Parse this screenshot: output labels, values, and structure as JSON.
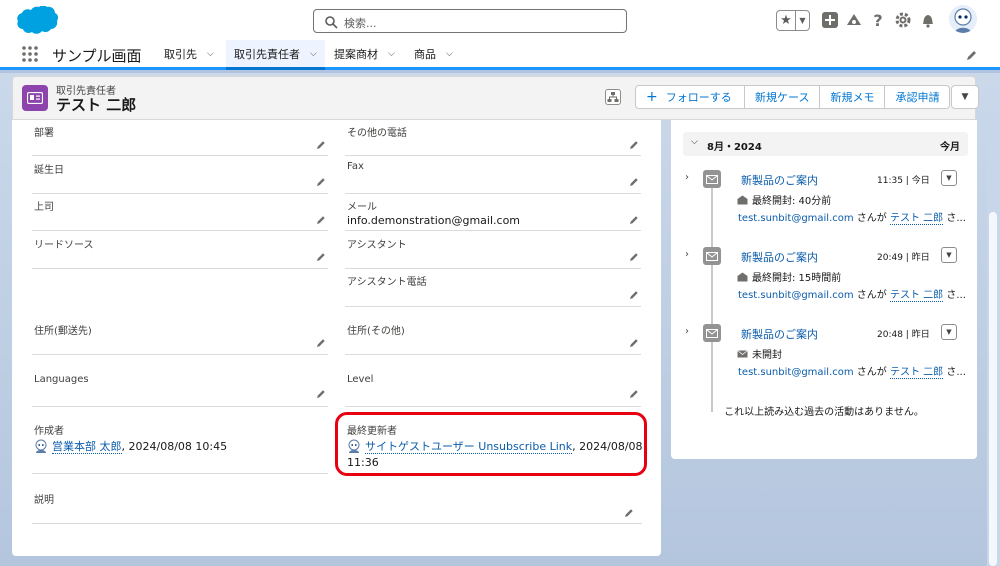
{
  "header": {
    "search_placeholder": "検索...",
    "colors": {
      "brand": "#00a1e0",
      "accent": "#0176d3",
      "highlight": "#e60012"
    }
  },
  "nav": {
    "app_name": "サンプル画面",
    "tabs": [
      {
        "label": "取引先"
      },
      {
        "label": "取引先責任者",
        "active": true
      },
      {
        "label": "提案商材"
      },
      {
        "label": "商品"
      }
    ]
  },
  "record": {
    "type": "取引先責任者",
    "name": "テスト 二郎",
    "buttons": {
      "follow": "フォローする",
      "new_case": "新規ケース",
      "new_memo": "新規メモ",
      "approval": "承認申請"
    }
  },
  "details": {
    "left": [
      {
        "label": "部署",
        "value": ""
      },
      {
        "label": "誕生日",
        "value": ""
      },
      {
        "label": "上司",
        "value": ""
      },
      {
        "label": "リードソース",
        "value": ""
      },
      {
        "label": "住所(郵送先)",
        "value": ""
      },
      {
        "label": "Languages",
        "value": ""
      },
      {
        "label": "作成者",
        "user": "営業本部 太郎",
        "date": ", 2024/08/08 10:45"
      },
      {
        "label": "説明",
        "value": ""
      }
    ],
    "right": [
      {
        "label": "その他の電話",
        "value": ""
      },
      {
        "label": "Fax",
        "value": ""
      },
      {
        "label": "メール",
        "value": "info.demonstration@gmail.com"
      },
      {
        "label": "アシスタント",
        "value": ""
      },
      {
        "label": "アシスタント電話",
        "value": ""
      },
      {
        "label": "住所(その他)",
        "value": ""
      },
      {
        "label": "Level",
        "value": ""
      },
      {
        "label": "最終更新者",
        "user": "サイトゲストユーザー Unsubscribe Link",
        "date": ", 2024/08/08",
        "date2": "11:36"
      }
    ]
  },
  "activity": {
    "month": "8月・2024",
    "this_month": "今月",
    "items": [
      {
        "subject": "新製品のご案内",
        "time": "11:35 | 今日",
        "opened": "最終開封: 40分前",
        "sender": "test.sunbit@gmail.com",
        "mid": " さんが ",
        "to": "テスト 二郎",
        "tail": " さ..."
      },
      {
        "subject": "新製品のご案内",
        "time": "20:49 | 昨日",
        "opened": "最終開封: 15時間前",
        "sender": "test.sunbit@gmail.com",
        "mid": " さんが ",
        "to": "テスト 二郎",
        "tail": " さ..."
      },
      {
        "subject": "新製品のご案内",
        "time": "20:48 | 昨日",
        "opened": "未開封",
        "sender": "test.sunbit@gmail.com",
        "mid": " さんが ",
        "to": "テスト 二郎",
        "tail": " さ..."
      }
    ],
    "no_more": "これ以上読み込む過去の活動はありません。"
  }
}
